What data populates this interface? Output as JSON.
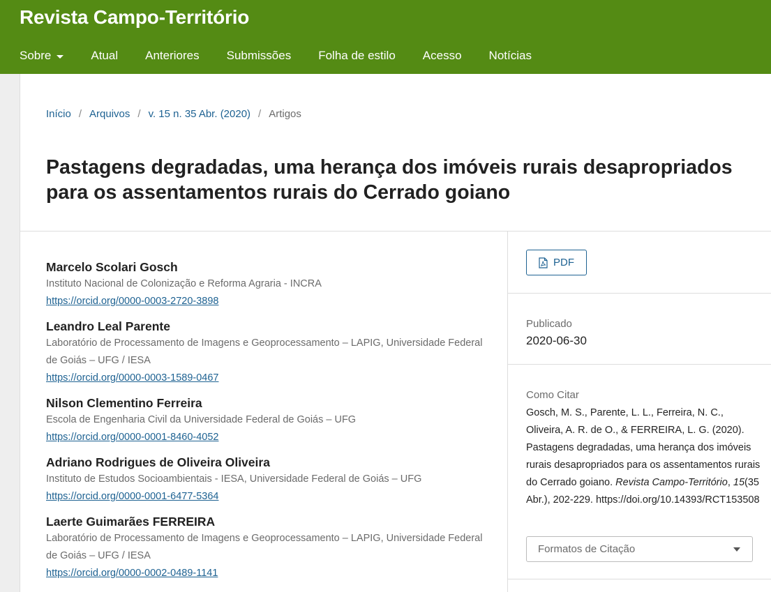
{
  "header": {
    "site_title": "Revista Campo-Território",
    "nav": [
      "Sobre",
      "Atual",
      "Anteriores",
      "Submissões",
      "Folha de estilo",
      "Acesso",
      "Notícias"
    ],
    "background": "#548b14"
  },
  "breadcrumb": {
    "items": [
      "Início",
      "Arquivos",
      "v. 15 n. 35 Abr. (2020)"
    ],
    "current": "Artigos",
    "separator": "/"
  },
  "article": {
    "title": "Pastagens degradadas, uma herança dos imóveis rurais desapropriados para os assentamentos rurais do Cerrado goiano"
  },
  "authors": [
    {
      "name": "Marcelo Scolari Gosch",
      "affiliation": "Instituto Nacional de Colonização e Reforma Agraria - INCRA",
      "orcid": "https://orcid.org/0000-0003-2720-3898"
    },
    {
      "name": "Leandro Leal Parente",
      "affiliation": "Laboratório de Processamento de Imagens e Geoprocessamento – LAPIG, Universidade Federal de Goiás – UFG / IESA",
      "orcid": "https://orcid.org/0000-0003-1589-0467"
    },
    {
      "name": "Nilson Clementino Ferreira",
      "affiliation": "Escola de Engenharia Civil da Universidade Federal de Goiás – UFG",
      "orcid": "https://orcid.org/0000-0001-8460-4052"
    },
    {
      "name": "Adriano Rodrigues de Oliveira Oliveira",
      "affiliation": "Instituto de Estudos Socioambientais - IESA, Universidade Federal de Goiás – UFG",
      "orcid": "https://orcid.org/0000-0001-6477-5364"
    },
    {
      "name": "Laerte Guimarães FERREIRA",
      "affiliation": "Laboratório de Processamento de Imagens e Geoprocessamento – LAPIG, Universidade Federal de Goiás – UFG / IESA",
      "orcid": "https://orcid.org/0000-0002-0489-1141"
    }
  ],
  "sidebar": {
    "pdf_label": "PDF",
    "pdf_icon": "pdf-file-icon",
    "published_label": "Publicado",
    "published_value": "2020-06-30",
    "cite_label": "Como Citar",
    "citation": {
      "before": "Gosch, M. S., Parente, L. L., Ferreira, N. C., Oliveira, A. R. de O., & FERREIRA, L. G. (2020). Pastagens degradadas, uma herança dos imóveis rurais desapropriados para os assentamentos rurais do Cerrado goiano. ",
      "journal": "Revista Campo-Território",
      "sep1": ", ",
      "volume": "15",
      "rest": "(35 Abr.), 202-229. https://doi.org/10.14393/RCT153508"
    },
    "formats_label": "Formatos de Citação"
  },
  "colors": {
    "link": "#1e6292",
    "muted": "#6b6b6b"
  }
}
